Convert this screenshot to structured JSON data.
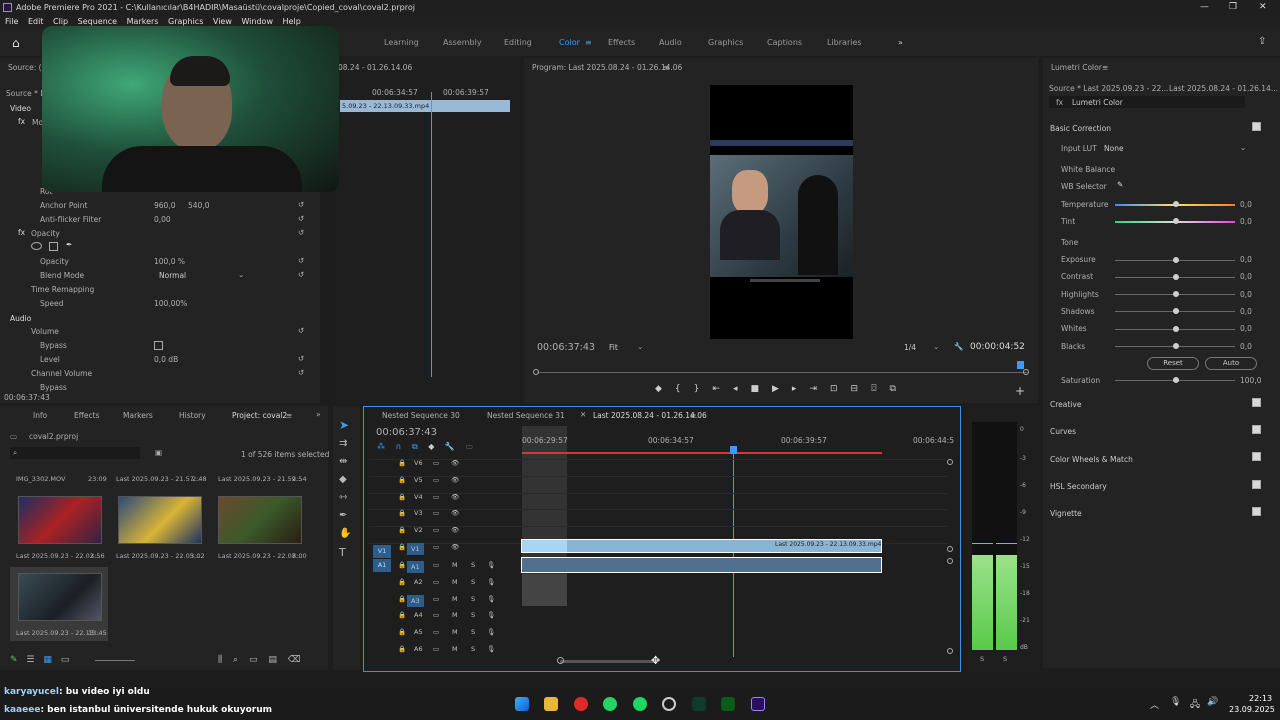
{
  "window": {
    "title": "Adobe Premiere Pro 2021 - C:\\Kullanıcılar\\B4HADIR\\Masaüstü\\covalproje\\Copied_coval\\coval2.prproj"
  },
  "menu": [
    "File",
    "Edit",
    "Clip",
    "Sequence",
    "Markers",
    "Graphics",
    "View",
    "Window",
    "Help"
  ],
  "workspaces": [
    "Learning",
    "Assembly",
    "Editing",
    "Color",
    "Effects",
    "Audio",
    "Graphics",
    "Captions",
    "Libraries"
  ],
  "active_workspace": "Color",
  "effect_controls": {
    "source_label": "Source: (",
    "source_seq": "Source * L",
    "video_label": "Video",
    "motion_label": "Mo",
    "rotation_label": "Rot",
    "anchor_label": "Anchor Point",
    "anchor_x": "960,0",
    "anchor_y": "540,0",
    "antiflicker_label": "Anti-flicker Filter",
    "antiflicker_value": "0,00",
    "opacity_section": "Opacity",
    "opacity_label": "Opacity",
    "opacity_value": "100,0 %",
    "blend_label": "Blend Mode",
    "blend_value": "Normal",
    "time_remap": "Time Remapping",
    "speed_label": "Speed",
    "speed_value": "100,00%",
    "audio_label": "Audio",
    "volume_label": "Volume",
    "bypass_label": "Bypass",
    "level_label": "Level",
    "level_value": "0,0 dB",
    "channel_volume_label": "Channel Volume",
    "bypass2_label": "Bypass",
    "timecode": "00:06:37:43",
    "mini_tc1": "00:06:34:57",
    "mini_tc2": "00:06:39:57",
    "mini_header": "08.24 - 01.26.14.06",
    "mini_clip": "5.09.23 - 22.13.09.33.mp4"
  },
  "program": {
    "title": "Program: Last 2025.08.24 - 01.26.14.06",
    "timecode": "00:06:37:43",
    "fit": "Fit",
    "resolution": "1/4",
    "duration": "00:00:04:52"
  },
  "lumetri": {
    "panel_title": "Lumetri Color",
    "source": "Source * Last 2025.09.23 - 22...",
    "sequence": "Last 2025.08.24 - 01.26.14...",
    "effect_select": "Lumetri Color",
    "basic_correction": "Basic Correction",
    "input_lut_label": "Input LUT",
    "input_lut_value": "None",
    "white_balance": "White Balance",
    "wb_selector": "WB Selector",
    "temperature_label": "Temperature",
    "temperature_value": "0,0",
    "tint_label": "Tint",
    "tint_value": "0,0",
    "tone": "Tone",
    "exposure_label": "Exposure",
    "exposure_value": "0,0",
    "contrast_label": "Contrast",
    "contrast_value": "0,0",
    "highlights_label": "Highlights",
    "highlights_value": "0,0",
    "shadows_label": "Shadows",
    "shadows_value": "0,0",
    "whites_label": "Whites",
    "whites_value": "0,0",
    "blacks_label": "Blacks",
    "blacks_value": "0,0",
    "reset": "Reset",
    "auto": "Auto",
    "saturation_label": "Saturation",
    "saturation_value": "100,0",
    "sections": [
      "Creative",
      "Curves",
      "Color Wheels & Match",
      "HSL Secondary",
      "Vignette"
    ]
  },
  "project": {
    "tabs": [
      "Info",
      "Effects",
      "Markers",
      "History",
      "Project: coval2"
    ],
    "file": "coval2.prproj",
    "count": "1 of 526 items selected",
    "items": [
      {
        "name": "IMG_3302.MOV",
        "dur": "23:09"
      },
      {
        "name": "Last 2025.09.23 - 21.57...",
        "dur": "2:48"
      },
      {
        "name": "Last 2025.09.23 - 21.59...",
        "dur": "2:54"
      },
      {
        "name": "Last 2025.09.23 - 22.02...",
        "dur": "3:56"
      },
      {
        "name": "Last 2025.09.23 - 22.05...",
        "dur": "3:02"
      },
      {
        "name": "Last 2025.09.23 - 22.07...",
        "dur": "8:00"
      },
      {
        "name": "Last 2025.09.23 - 22.13...",
        "dur": "13:45"
      }
    ]
  },
  "timeline": {
    "tabs": [
      "Nested Sequence 30",
      "Nested Sequence 31",
      "Last 2025.08.24 - 01.26.14.06"
    ],
    "timecode": "00:06:37:43",
    "ruler": [
      "00:06:29:57",
      "00:06:34:57",
      "00:06:39:57",
      "00:06:44:5"
    ],
    "video_tracks": [
      "V6",
      "V5",
      "V4",
      "V3",
      "V2",
      "V1"
    ],
    "audio_tracks": [
      "A1",
      "A2",
      "A3",
      "A4",
      "A5",
      "A6"
    ],
    "source_v": "V1",
    "source_a": "A1",
    "clip_label": "Last 2025.09.23 - 22.13.09.33.mp4 [V"
  },
  "meter_scale": [
    "0",
    "-3",
    "-6",
    "-9",
    "-12",
    "-15",
    "-18",
    "-21",
    "dB"
  ],
  "meter_footer": [
    "S",
    "S"
  ],
  "chat": [
    {
      "user": "karyayucel",
      "text": ": bu video iyi oldu"
    },
    {
      "user": "kaaeee",
      "text": ": ben istanbul üniversitende hukuk okuyorum"
    }
  ],
  "clock": {
    "time": "22:13",
    "date": "23.09.2025"
  }
}
